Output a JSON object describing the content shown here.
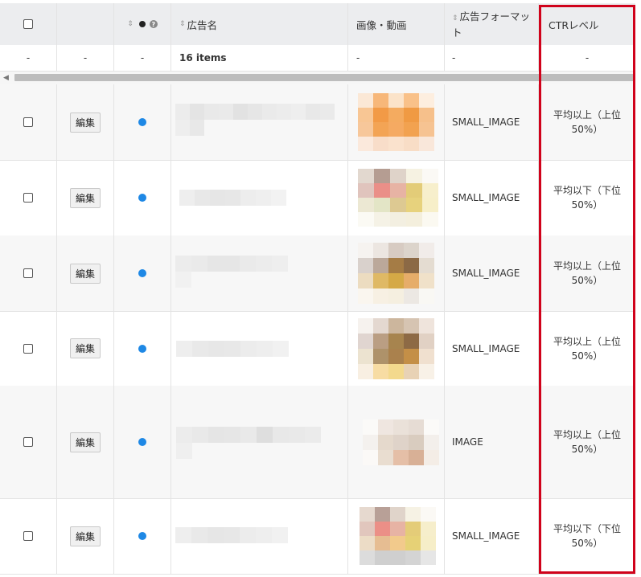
{
  "header": {
    "name_col": "広告名",
    "image_col": "画像・動画",
    "format_col": "広告フォーマット",
    "ctr_col": "CTRレベル"
  },
  "filter_row": {
    "c0": "-",
    "c1": "-",
    "c2": "-",
    "items": "16 items",
    "c4": "-",
    "c5": "-",
    "c6": "-"
  },
  "colors": {
    "status_dot": "#1e88e5",
    "highlight_border": "#d0021b",
    "header_bg": "#ecedef"
  },
  "rows": [
    {
      "edit": "編集",
      "format": "SMALL_IMAGE",
      "ctr": "平均以上（上位50%）"
    },
    {
      "edit": "編集",
      "format": "SMALL_IMAGE",
      "ctr": "平均以下（下位50%）"
    },
    {
      "edit": "編集",
      "format": "SMALL_IMAGE",
      "ctr": "平均以上（上位50%）"
    },
    {
      "edit": "編集",
      "format": "SMALL_IMAGE",
      "ctr": "平均以上（上位50%）"
    },
    {
      "edit": "編集",
      "format": "IMAGE",
      "ctr": "平均以上（上位50%）"
    },
    {
      "edit": "編集",
      "format": "SMALL_IMAGE",
      "ctr": "平均以下（下位50%）"
    }
  ]
}
